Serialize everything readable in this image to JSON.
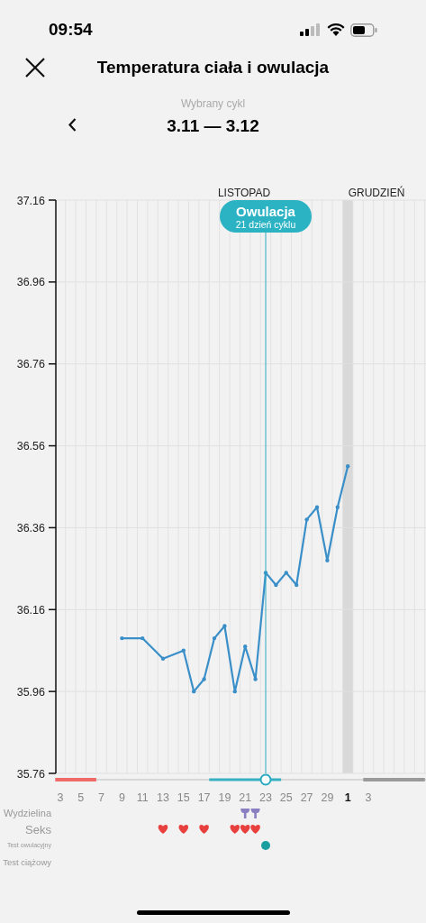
{
  "status_bar": {
    "time": "09:54"
  },
  "header": {
    "title": "Temperatura ciała i owulacja"
  },
  "cycle": {
    "label": "Wybrany cykl",
    "range": "3.11 — 3.12"
  },
  "months": [
    {
      "label": "LISTOPAD"
    },
    {
      "label": "GRUDZIEŃ"
    }
  ],
  "ovulation": {
    "title": "Owulacja",
    "subtitle": "21 dzień cyklu"
  },
  "today": {
    "highlighted": true
  },
  "cycle_phases": [
    {
      "kind": "period"
    },
    {
      "kind": "fertile"
    },
    {
      "kind": "predicted_period"
    }
  ],
  "chart_data": {
    "type": "line",
    "grid": true,
    "ylim": [
      35.76,
      37.16
    ],
    "categories": [
      "3",
      null,
      "5",
      null,
      "7",
      null,
      "9",
      null,
      "11",
      null,
      "13",
      null,
      "15",
      null,
      "17",
      null,
      "19",
      null,
      "21",
      null,
      "23",
      null,
      "25",
      null,
      "27",
      null,
      "29",
      null,
      "1",
      null,
      "3",
      null,
      null,
      null,
      null,
      null
    ],
    "series": [
      {
        "color": "#3a8fc9",
        "values": [
          null,
          null,
          null,
          null,
          null,
          null,
          36.09,
          null,
          36.09,
          null,
          36.04,
          null,
          36.06,
          35.96,
          35.99,
          36.09,
          36.12,
          35.96,
          36.07,
          35.99,
          36.25,
          36.22,
          36.25,
          36.22,
          36.38,
          36.41,
          36.28,
          36.41,
          36.51,
          null,
          null,
          null,
          null,
          null,
          null,
          null
        ]
      }
    ],
    "yticks": [
      {
        "value": 35.76,
        "label": "35.76"
      },
      {
        "value": 35.96,
        "label": "35.96"
      },
      {
        "value": 36.16,
        "label": "36.16"
      },
      {
        "value": 36.36,
        "label": "36.36"
      },
      {
        "value": 36.56,
        "label": "36.56"
      },
      {
        "value": 36.76,
        "label": "36.76"
      },
      {
        "value": 36.96,
        "label": "36.96"
      },
      {
        "value": 37.16,
        "label": "37.16"
      }
    ]
  },
  "event_rows": [
    {
      "label": "Wydzielina",
      "kind": "discharge",
      "marks": [
        false,
        false,
        false,
        false,
        false,
        false,
        false,
        false,
        false,
        false,
        false,
        false,
        false,
        false,
        false,
        false,
        false,
        false,
        true,
        true,
        false,
        false,
        false,
        false,
        false,
        false,
        false,
        false,
        false,
        false,
        false,
        false,
        false,
        false,
        false,
        false
      ]
    },
    {
      "label": "Seks",
      "kind": "sex",
      "marks": [
        false,
        false,
        false,
        false,
        false,
        false,
        false,
        false,
        false,
        false,
        true,
        false,
        true,
        false,
        true,
        false,
        false,
        true,
        true,
        true,
        false,
        false,
        false,
        false,
        false,
        false,
        false,
        false,
        false,
        false,
        false,
        false,
        false,
        false,
        false,
        false
      ]
    },
    {
      "label": "Test owulacyjny",
      "kind": "ovulation_test",
      "marks": [
        false,
        false,
        false,
        false,
        false,
        false,
        false,
        false,
        false,
        false,
        false,
        false,
        false,
        false,
        false,
        false,
        false,
        false,
        false,
        false,
        true,
        false,
        false,
        false,
        false,
        false,
        false,
        false,
        false,
        false,
        false,
        false,
        false,
        false,
        false,
        false
      ]
    },
    {
      "label": "Test ciążowy",
      "kind": "pregnancy_test",
      "marks": [
        false,
        false,
        false,
        false,
        false,
        false,
        false,
        false,
        false,
        false,
        false,
        false,
        false,
        false,
        false,
        false,
        false,
        false,
        false,
        false,
        false,
        false,
        false,
        false,
        false,
        false,
        false,
        false,
        false,
        false,
        false,
        false,
        false,
        false,
        false,
        false
      ]
    }
  ]
}
